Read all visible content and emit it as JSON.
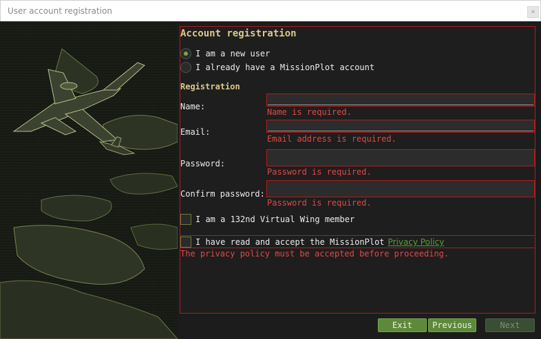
{
  "window": {
    "title": "User account registration"
  },
  "form": {
    "heading": "Account registration",
    "account_options": [
      {
        "label": "I am a new user",
        "selected": true
      },
      {
        "label": "I already have a MissionPlot account",
        "selected": false
      }
    ],
    "registration_heading": "Registration",
    "fields": {
      "name": {
        "label": "Name:",
        "value": "",
        "error": "Name is required."
      },
      "email": {
        "label": "Email:",
        "value": "",
        "error": "Email address is required."
      },
      "password": {
        "label": "Password:",
        "value": "",
        "error": "Password is required."
      },
      "confirm_password": {
        "label": "Confirm password:",
        "value": "",
        "error": "Password is required."
      }
    },
    "member_checkbox": {
      "label": "I am a 132nd Virtual Wing member",
      "checked": false
    },
    "privacy_checkbox": {
      "label": "I have read and accept the MissionPlot",
      "link": "Privacy Policy",
      "checked": false,
      "error": "The privacy policy must be accepted before proceeding."
    }
  },
  "buttons": {
    "exit": "Exit",
    "previous": "Previous",
    "next": "Next"
  },
  "colors": {
    "accent": "#5c8a3a",
    "error": "#e04848",
    "heading": "#d9c98d"
  }
}
